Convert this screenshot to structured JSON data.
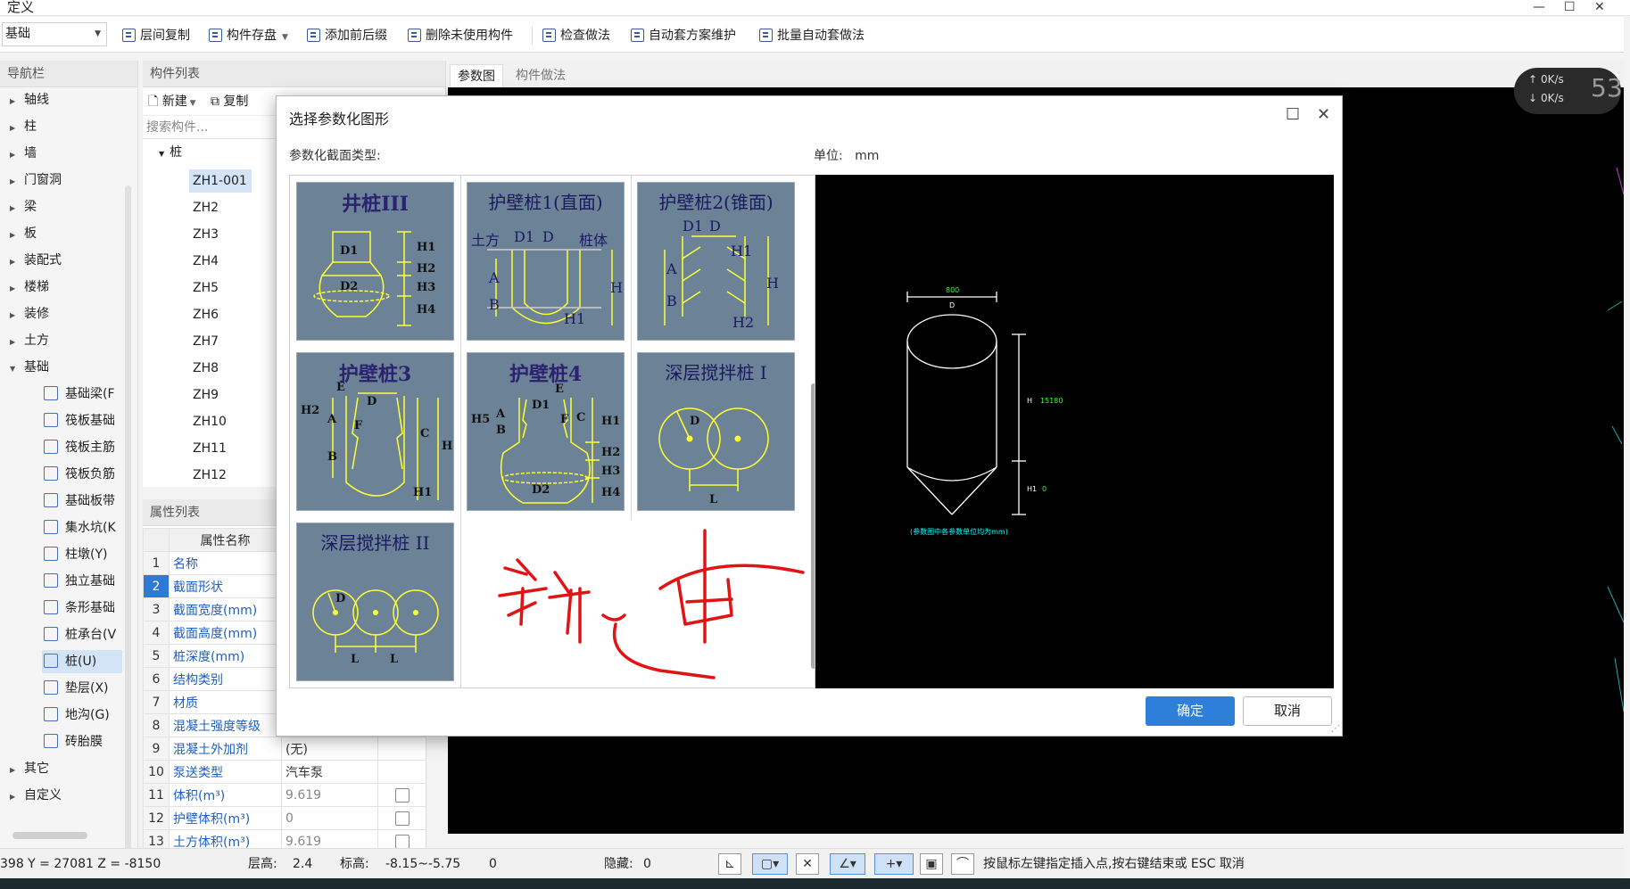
{
  "window": {
    "title": "定义",
    "minimize": "—",
    "maximize": "☐",
    "close": "✕"
  },
  "toolbar": {
    "combo_value": "基础",
    "buttons": [
      "层间复制",
      "构件存盘",
      "添加前后缀",
      "删除未使用构件",
      "检查做法",
      "自动套方案维护",
      "批量自动套做法"
    ]
  },
  "nav": {
    "title": "导航栏",
    "top_items": [
      "轴线",
      "柱",
      "墙",
      "门窗洞",
      "梁",
      "板",
      "装配式",
      "楼梯",
      "装修",
      "土方",
      "基础"
    ],
    "sub_items": [
      "基础梁(F",
      "筏板基础",
      "筏板主筋",
      "筏板负筋",
      "基础板带",
      "集水坑(K",
      "柱墩(Y)",
      "独立基础",
      "条形基础",
      "桩承台(V",
      "桩(U)",
      "垫层(X)",
      "地沟(G)",
      "砖胎膜"
    ],
    "bottom_items": [
      "其它",
      "自定义"
    ]
  },
  "component_list": {
    "title": "构件列表",
    "new_label": "新建",
    "copy_label": "复制",
    "search_placeholder": "搜索构件...",
    "root": "桩",
    "items": [
      "ZH1-001",
      "ZH2",
      "ZH3",
      "ZH4",
      "ZH5",
      "ZH6",
      "ZH7",
      "ZH8",
      "ZH9",
      "ZH10",
      "ZH11",
      "ZH12"
    ]
  },
  "properties": {
    "title": "属性列表",
    "header": "属性名称",
    "rows": [
      {
        "n": "1",
        "name": "名称",
        "value": ""
      },
      {
        "n": "2",
        "name": "截面形状",
        "value": ""
      },
      {
        "n": "3",
        "name": "截面宽度(mm)",
        "value": ""
      },
      {
        "n": "4",
        "name": "截面高度(mm)",
        "value": ""
      },
      {
        "n": "5",
        "name": "桩深度(mm)",
        "value": ""
      },
      {
        "n": "6",
        "name": "结构类别",
        "value": ""
      },
      {
        "n": "7",
        "name": "材质",
        "value": ""
      },
      {
        "n": "8",
        "name": "混凝土强度等级",
        "value": ""
      },
      {
        "n": "9",
        "name": "混凝土外加剂",
        "value": "(无)"
      },
      {
        "n": "10",
        "name": "泵送类型",
        "value": "汽车泵"
      },
      {
        "n": "11",
        "name": "体积(m³)",
        "value": "9.619"
      },
      {
        "n": "12",
        "name": "护壁体积(m³)",
        "value": "0"
      },
      {
        "n": "13",
        "name": "土方体积(m³)",
        "value": "9.619"
      }
    ]
  },
  "canvas_tabs": [
    "参数图",
    "构件做法"
  ],
  "speed_widget": {
    "up": "0K/s",
    "down": "0K/s",
    "big": "53"
  },
  "status": {
    "coords": "398 Y = 27081 Z = -8150",
    "floor_height_label": "层高:",
    "floor_height": "2.4",
    "elevation_label": "标高:",
    "elevation": "-8.15~-5.75",
    "zero": "0",
    "hidden_label": "隐藏:",
    "hidden": "0",
    "hint": "按鼠标左键指定插入点,按右键结束或 ESC 取消"
  },
  "dialog": {
    "title": "选择参数化图形",
    "section_label": "参数化截面类型:",
    "unit_label": "单位:",
    "unit_value": "mm",
    "ok": "确定",
    "cancel": "取消",
    "tiles": [
      {
        "title": "井桩III",
        "labels": [
          "D1",
          "D2",
          "H1",
          "H2",
          "H3",
          "H4"
        ]
      },
      {
        "title": "护壁桩1(直面)",
        "labels": [
          "土方",
          "D1",
          "D",
          "桩体",
          "A",
          "B",
          "H",
          "H1"
        ]
      },
      {
        "title": "护壁桩2(锥面)",
        "labels": [
          "D1",
          "D",
          "H1",
          "A",
          "H",
          "B",
          "H2"
        ]
      },
      {
        "title": "护壁桩3",
        "labels": [
          "E",
          "D",
          "H2",
          "A",
          "F",
          "C",
          "H",
          "B",
          "H1"
        ]
      },
      {
        "title": "护壁桩4",
        "labels": [
          "E",
          "D1",
          "H5",
          "A",
          "B",
          "F",
          "C",
          "H1",
          "H2",
          "D2",
          "H3",
          "H4"
        ]
      },
      {
        "title": "深层搅拌桩 I",
        "labels": [
          "D",
          "L"
        ]
      },
      {
        "title": "深层搅拌桩 II",
        "labels": [
          "D",
          "L",
          "L"
        ]
      }
    ],
    "preview": {
      "dim_d_value": "800",
      "dim_d_label": "D",
      "dim_h_label": "H",
      "dim_h_value": "15180",
      "dim_h1_label": "H1",
      "dim_h1_value": "0",
      "note": "(参数图中各参数单位均为mm)"
    }
  },
  "colors": {
    "tile_bg": "#6c8297",
    "tile_title": "#2b2370",
    "tile_line": "#ffff33",
    "accent": "#2e7fd8",
    "preview_line": "#ffffff",
    "preview_dim": "#33ff33",
    "preview_note": "#00ffff",
    "annotation": "#e01414"
  }
}
